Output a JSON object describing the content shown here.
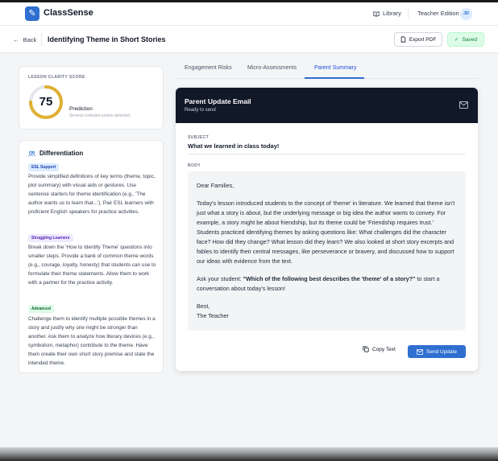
{
  "app": {
    "name": "ClassSense",
    "logo_glyph": "✎"
  },
  "header": {
    "library_label": "Library",
    "edition_label": "Teacher Edition",
    "avatar_initials": "JD"
  },
  "subheader": {
    "back_label": "Back",
    "lesson_title": "Identifying Theme in Short Stories",
    "export_label": "Export PDF",
    "saved_label": "Saved"
  },
  "clarity": {
    "eyebrow": "LESSON CLARITY SCORE",
    "score": "75",
    "score_fraction": 0.75,
    "prediction_label": "Prediction",
    "prediction_desc": "Several confusion points detected."
  },
  "differentiation": {
    "title": "Differentiation",
    "groups": [
      {
        "tag": "ESL Support",
        "text": "Provide simplified definitions of key terms (theme, topic, plot summary) with visual aids or gestures. Use sentence starters for theme identification (e.g., 'The author wants us to learn that...'). Pair ESL learners with proficient English speakers for practice activities."
      },
      {
        "tag": "Struggling Learners",
        "text": "Break down the 'How to Identify Theme' questions into smaller steps. Provide a bank of common theme words (e.g., courage, loyalty, honesty) that students can use to formulate their theme statements. Allow them to work with a partner for the practice activity."
      },
      {
        "tag": "Advanced",
        "text": "Challenge them to identify multiple possible themes in a story and justify why one might be stronger than another. Ask them to analyze how literary devices (e.g., symbolism, metaphor) contribute to the theme. Have them create their own short story premise and state the intended theme."
      }
    ]
  },
  "tabs": {
    "engagement": "Engagement Risks",
    "micro": "Micro-Assessments",
    "parent": "Parent Summary"
  },
  "email": {
    "title": "Parent Update Email",
    "status": "Ready to send",
    "subject_label": "SUBJECT",
    "subject": "What we learned in class today!",
    "body_label": "BODY",
    "greeting": "Dear Families,",
    "paragraph": "Today's lesson introduced students to the concept of 'theme' in literature. We learned that theme isn't just what a story is about, but the underlying message or big idea the author wants to convey. For example, a story might be about friendship, but its theme could be 'Friendship requires trust.' Students practiced identifying themes by asking questions like: What challenges did the character face? How did they change? What lesson did they learn? We also looked at short story excerpts and fables to identify their central messages, like perseverance or bravery, and discussed how to support our ideas with evidence from the text.",
    "ask_prefix": "Ask your student: ",
    "ask_question": "\"Which of the following best describes the 'theme' of a story?\"",
    "ask_suffix": " to start a conversation about today's lesson!",
    "signoff": "Best,",
    "signature": "The Teacher",
    "copy_label": "Copy Text",
    "send_label": "Send Update"
  },
  "colors": {
    "accent": "#2f6fd0",
    "score_ring": "#e0b033",
    "header_dark": "#111827",
    "saved_green": "#15803d"
  }
}
